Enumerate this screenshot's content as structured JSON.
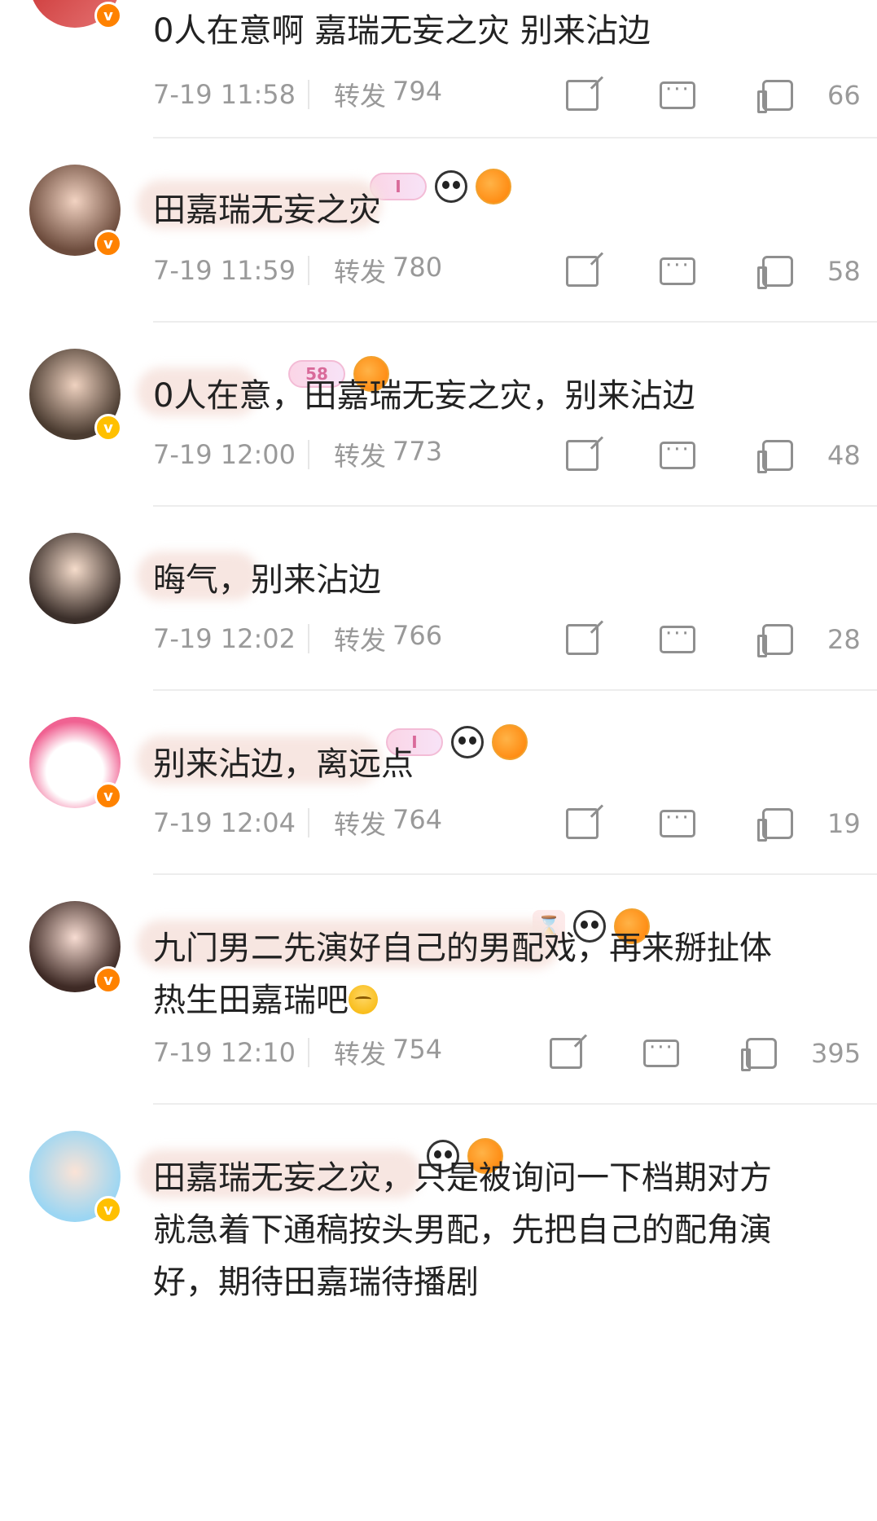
{
  "colors": {
    "accent": "#eb7350",
    "meta": "#999999",
    "badge_orange": "#ff8200",
    "badge_yellow": "#ffc000"
  },
  "comments": [
    {
      "username": "",
      "badges": [],
      "verify": "orange",
      "text": "0人在意啊 嘉瑞无妄之灾 别来沾边",
      "time": "7-19 11:58",
      "repost_label": "转发",
      "repost_count": "794",
      "likes": "66"
    },
    {
      "username": "",
      "badges": [
        "pill",
        "panda",
        "fish"
      ],
      "badge_pill_text": "I",
      "verify": "orange",
      "text": "田嘉瑞无妄之灾",
      "time": "7-19 11:59",
      "repost_label": "转发",
      "repost_count": "780",
      "likes": "58"
    },
    {
      "username": "",
      "badges": [
        "pill",
        "fish"
      ],
      "badge_pill_text": "58",
      "verify": "yellow",
      "text": "0人在意，田嘉瑞无妄之灾，别来沾边",
      "time": "7-19 12:00",
      "repost_label": "转发",
      "repost_count": "773",
      "likes": "48"
    },
    {
      "username": "",
      "badges": [],
      "verify": "none",
      "text": "晦气，别来沾边",
      "time": "7-19 12:02",
      "repost_label": "转发",
      "repost_count": "766",
      "likes": "28"
    },
    {
      "username": "",
      "badges": [
        "pill",
        "panda",
        "fish"
      ],
      "badge_pill_text": "I",
      "verify": "orange",
      "text": "别来沾边，离远点",
      "time": "7-19 12:04",
      "repost_label": "转发",
      "repost_count": "764",
      "likes": "19"
    },
    {
      "username": "",
      "badges": [
        "hourglass",
        "panda",
        "fish"
      ],
      "verify": "orange",
      "text_line1": "九门男二先演好自己的男配戏，再来掰扯体",
      "text_line2": "热生田嘉瑞吧",
      "emoji": "thinking-face",
      "time": "7-19 12:10",
      "repost_label": "转发",
      "repost_count": "754",
      "likes": "395"
    },
    {
      "username": "",
      "badges": [
        "panda",
        "fish"
      ],
      "verify": "yellow",
      "text_line1": "田嘉瑞无妄之灾，只是被询问一下档期对方",
      "text_line2": "就急着下通稿按头男配，先把自己的配角演",
      "text_line3": "好，期待田嘉瑞待播剧"
    }
  ]
}
